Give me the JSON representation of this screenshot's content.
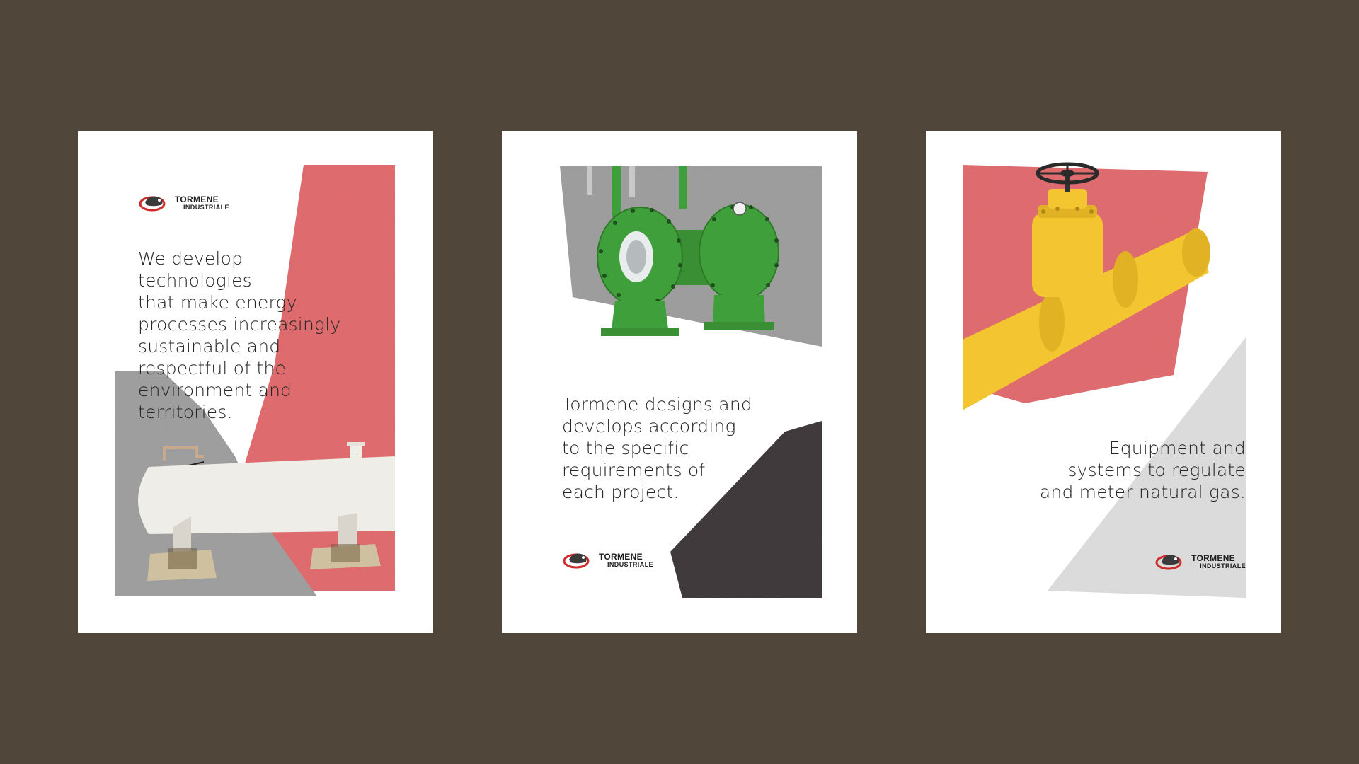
{
  "colors": {
    "background": "#51463a",
    "poster": "#ffffff",
    "red": "#e0676a",
    "gray": "#9e9e9e",
    "dark": "#3b3538",
    "green": "#3f9f3a",
    "yellow": "#f2c531",
    "light_gray": "#dcdcdc",
    "cream": "#efede7"
  },
  "brand": {
    "line1": "TORMENE",
    "line2": "INDUSTRIALE",
    "icon": "tormene-logo-icon"
  },
  "posters": [
    {
      "headline": "We develop\ntechnologies\nthat make energy\nprocesses increasingly\nsustainable and\nrespectful of the\nenvironment and\nterritories.",
      "illustration": "pressure-vessel-illustration"
    },
    {
      "headline": "Tormene designs and\ndevelops according\nto the specific\nrequirements of\neach project.",
      "illustration": "green-valves-illustration"
    },
    {
      "headline": "Equipment and\nsystems to regulate\nand meter natural gas.",
      "illustration": "yellow-valve-illustration"
    }
  ]
}
